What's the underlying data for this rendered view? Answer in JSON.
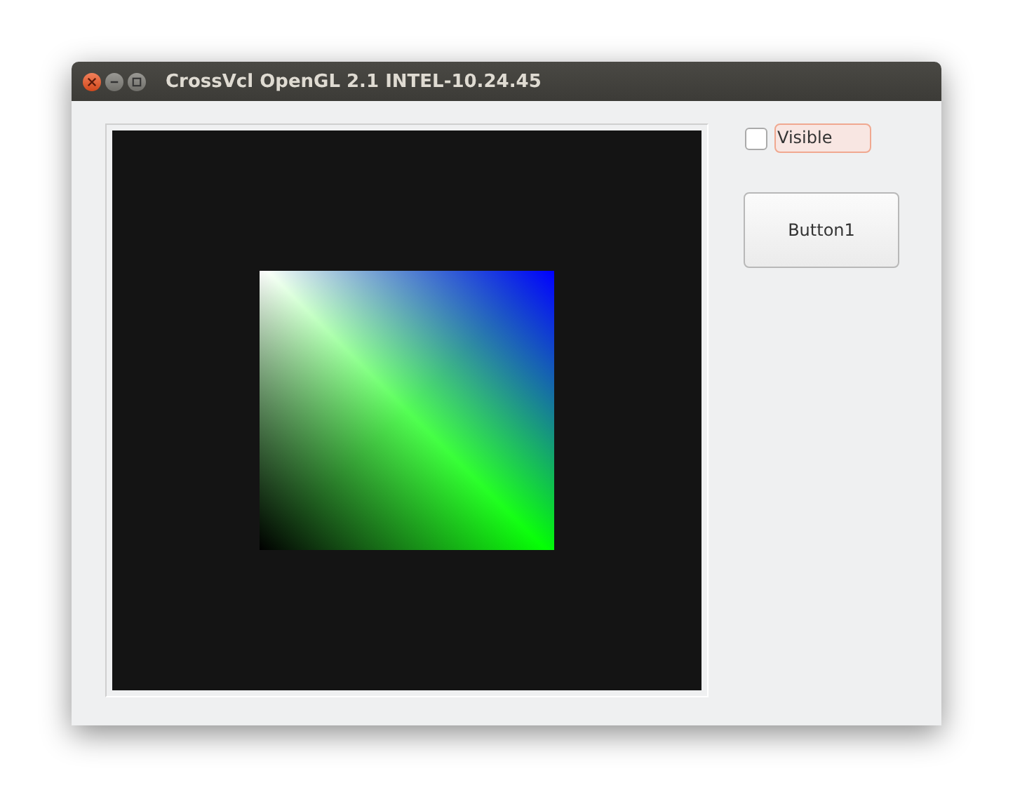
{
  "window": {
    "title": "CrossVcl OpenGL 2.1 INTEL-10.24.45"
  },
  "visible_checkbox": {
    "label": "Visible",
    "checked": false
  },
  "button": {
    "label": "Button1"
  }
}
